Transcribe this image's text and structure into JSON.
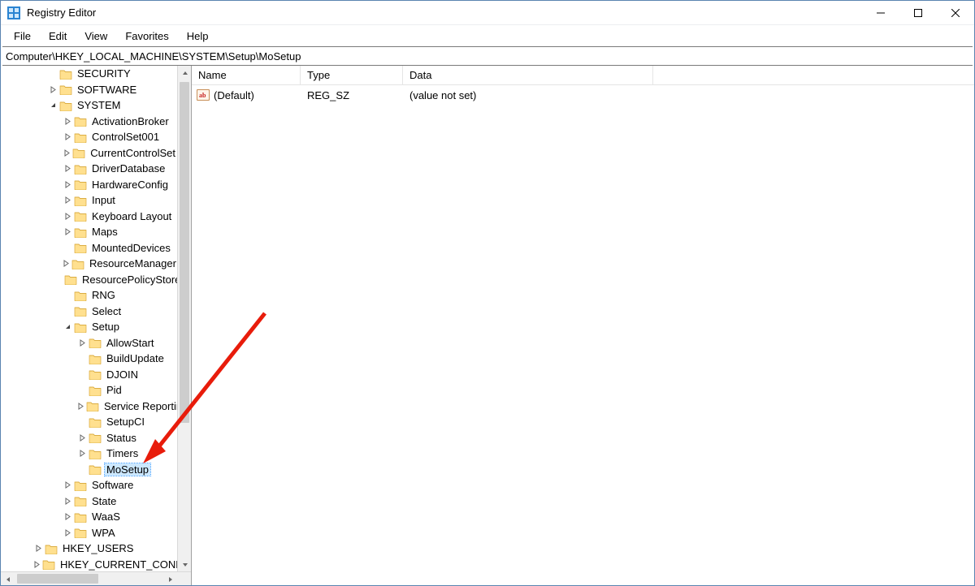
{
  "window": {
    "title": "Registry Editor"
  },
  "menu": {
    "file": "File",
    "edit": "Edit",
    "view": "View",
    "favorites": "Favorites",
    "help": "Help"
  },
  "address": "Computer\\HKEY_LOCAL_MACHINE\\SYSTEM\\Setup\\MoSetup",
  "columns": {
    "name": "Name",
    "type": "Type",
    "data": "Data"
  },
  "values": [
    {
      "name": "(Default)",
      "type": "REG_SZ",
      "data": "(value not set)"
    }
  ],
  "tree": [
    {
      "indent": 3,
      "exp": "none",
      "label": "SECURITY"
    },
    {
      "indent": 3,
      "exp": "right",
      "label": "SOFTWARE"
    },
    {
      "indent": 3,
      "exp": "down",
      "label": "SYSTEM"
    },
    {
      "indent": 4,
      "exp": "right",
      "label": "ActivationBroker"
    },
    {
      "indent": 4,
      "exp": "right",
      "label": "ControlSet001"
    },
    {
      "indent": 4,
      "exp": "right",
      "label": "CurrentControlSet"
    },
    {
      "indent": 4,
      "exp": "right",
      "label": "DriverDatabase"
    },
    {
      "indent": 4,
      "exp": "right",
      "label": "HardwareConfig"
    },
    {
      "indent": 4,
      "exp": "right",
      "label": "Input"
    },
    {
      "indent": 4,
      "exp": "right",
      "label": "Keyboard Layout"
    },
    {
      "indent": 4,
      "exp": "right",
      "label": "Maps"
    },
    {
      "indent": 4,
      "exp": "none",
      "label": "MountedDevices"
    },
    {
      "indent": 4,
      "exp": "right",
      "label": "ResourceManager"
    },
    {
      "indent": 4,
      "exp": "none",
      "label": "ResourcePolicyStore"
    },
    {
      "indent": 4,
      "exp": "none",
      "label": "RNG"
    },
    {
      "indent": 4,
      "exp": "none",
      "label": "Select"
    },
    {
      "indent": 4,
      "exp": "down",
      "label": "Setup"
    },
    {
      "indent": 5,
      "exp": "right",
      "label": "AllowStart"
    },
    {
      "indent": 5,
      "exp": "none",
      "label": "BuildUpdate"
    },
    {
      "indent": 5,
      "exp": "none",
      "label": "DJOIN"
    },
    {
      "indent": 5,
      "exp": "none",
      "label": "Pid"
    },
    {
      "indent": 5,
      "exp": "right",
      "label": "Service Reporting"
    },
    {
      "indent": 5,
      "exp": "none",
      "label": "SetupCI"
    },
    {
      "indent": 5,
      "exp": "right",
      "label": "Status"
    },
    {
      "indent": 5,
      "exp": "right",
      "label": "Timers"
    },
    {
      "indent": 5,
      "exp": "none",
      "label": "MoSetup",
      "selected": true
    },
    {
      "indent": 4,
      "exp": "right",
      "label": "Software"
    },
    {
      "indent": 4,
      "exp": "right",
      "label": "State"
    },
    {
      "indent": 4,
      "exp": "right",
      "label": "WaaS"
    },
    {
      "indent": 4,
      "exp": "right",
      "label": "WPA"
    },
    {
      "indent": 2,
      "exp": "right",
      "label": "HKEY_USERS"
    },
    {
      "indent": 2,
      "exp": "right",
      "label": "HKEY_CURRENT_CONFIG"
    }
  ]
}
